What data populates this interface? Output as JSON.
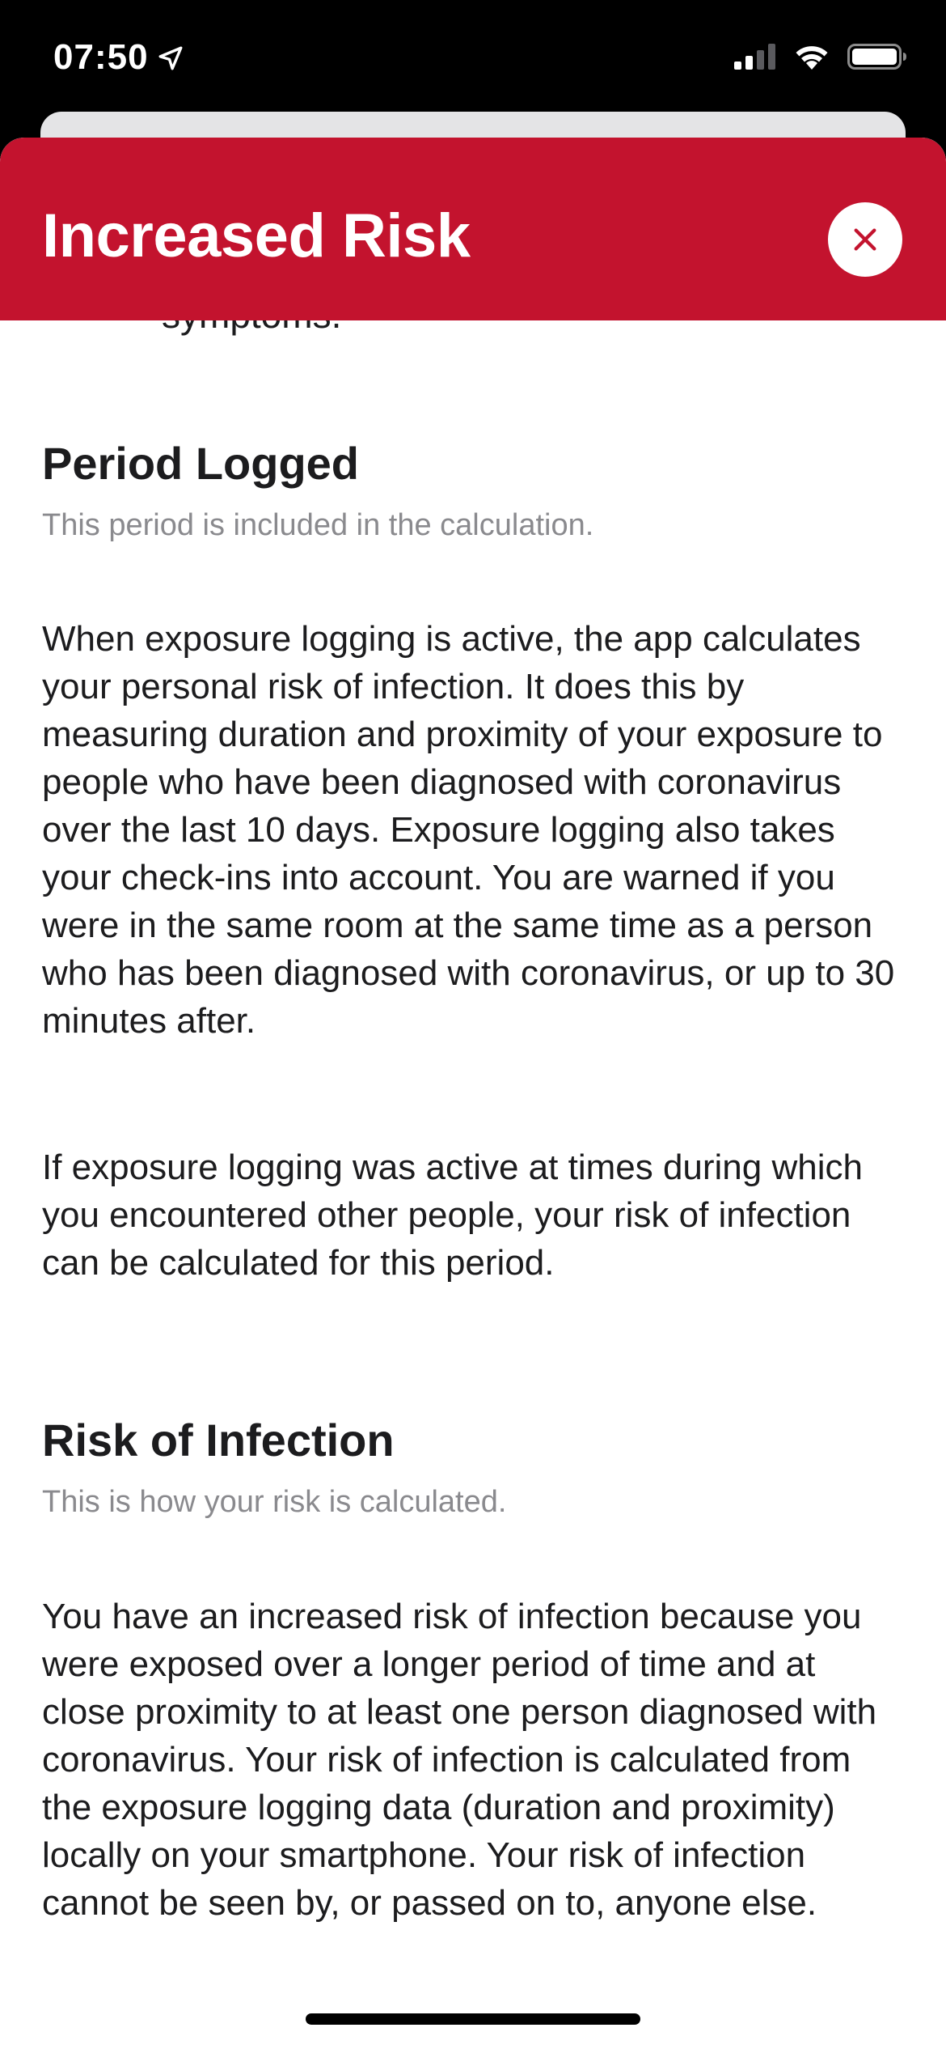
{
  "status_bar": {
    "time": "07:50"
  },
  "modal": {
    "title": "Increased Risk",
    "close_icon": "close-icon",
    "header_color": "#c3132e"
  },
  "content": {
    "cut_line": "symptoms.",
    "sections": [
      {
        "title": "Period Logged",
        "subtitle": "This period is included in the calculation.",
        "paragraphs": [
          "When exposure logging is active, the app calculates your personal risk of infection. It does this by measuring duration and proximity of your exposure to people who have been diagnosed with coronavirus over the last 10 days. Exposure logging also takes your check-ins into account. You are warned if you were in the same room at the same time as a person who has been diagnosed with coronavirus, or up to 30 minutes after.",
          "If exposure logging was active at times during which you encountered other people, your risk of infection can be calculated for this period."
        ]
      },
      {
        "title": "Risk of Infection",
        "subtitle": "This is how your risk is calculated.",
        "paragraphs": [
          "You have an increased risk of infection because you were exposed over a longer period of time and at close proximity to at least one person diagnosed with coronavirus. Your risk of infection is calculated from the exposure logging data (duration and proximity) locally on your smartphone. Your risk of infection cannot be seen by, or passed on to, anyone else."
        ]
      }
    ]
  }
}
